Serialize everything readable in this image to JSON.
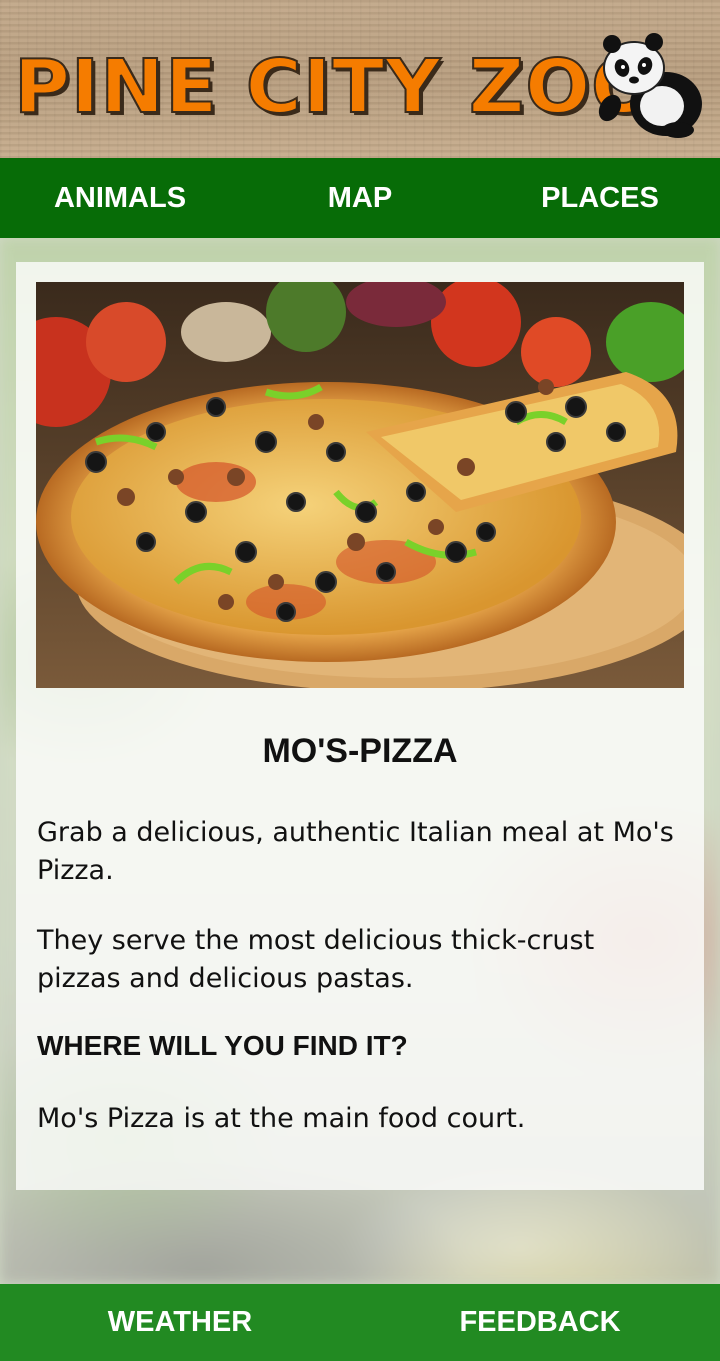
{
  "header": {
    "logo_text": "PINE CITY ZOO",
    "brand_color": "#f57c00",
    "mascot_icon": "panda-icon"
  },
  "top_nav": {
    "items": [
      {
        "label": "ANIMALS"
      },
      {
        "label": "MAP"
      },
      {
        "label": "PLACES"
      }
    ],
    "color": "#076c07"
  },
  "place": {
    "image": "pizza-photo",
    "title": "MO'S-PIZZA",
    "paragraphs": [
      "Grab a delicious, authentic Italian meal at Mo's Pizza.",
      "They serve the most delicious thick-crust pizzas and delicious pastas."
    ],
    "location_heading": "WHERE WILL YOU FIND IT?",
    "location_text": "Mo's Pizza is at the main food court."
  },
  "bottom_nav": {
    "items": [
      {
        "label": "WEATHER"
      },
      {
        "label": "FEEDBACK"
      }
    ],
    "color": "#228a22"
  }
}
